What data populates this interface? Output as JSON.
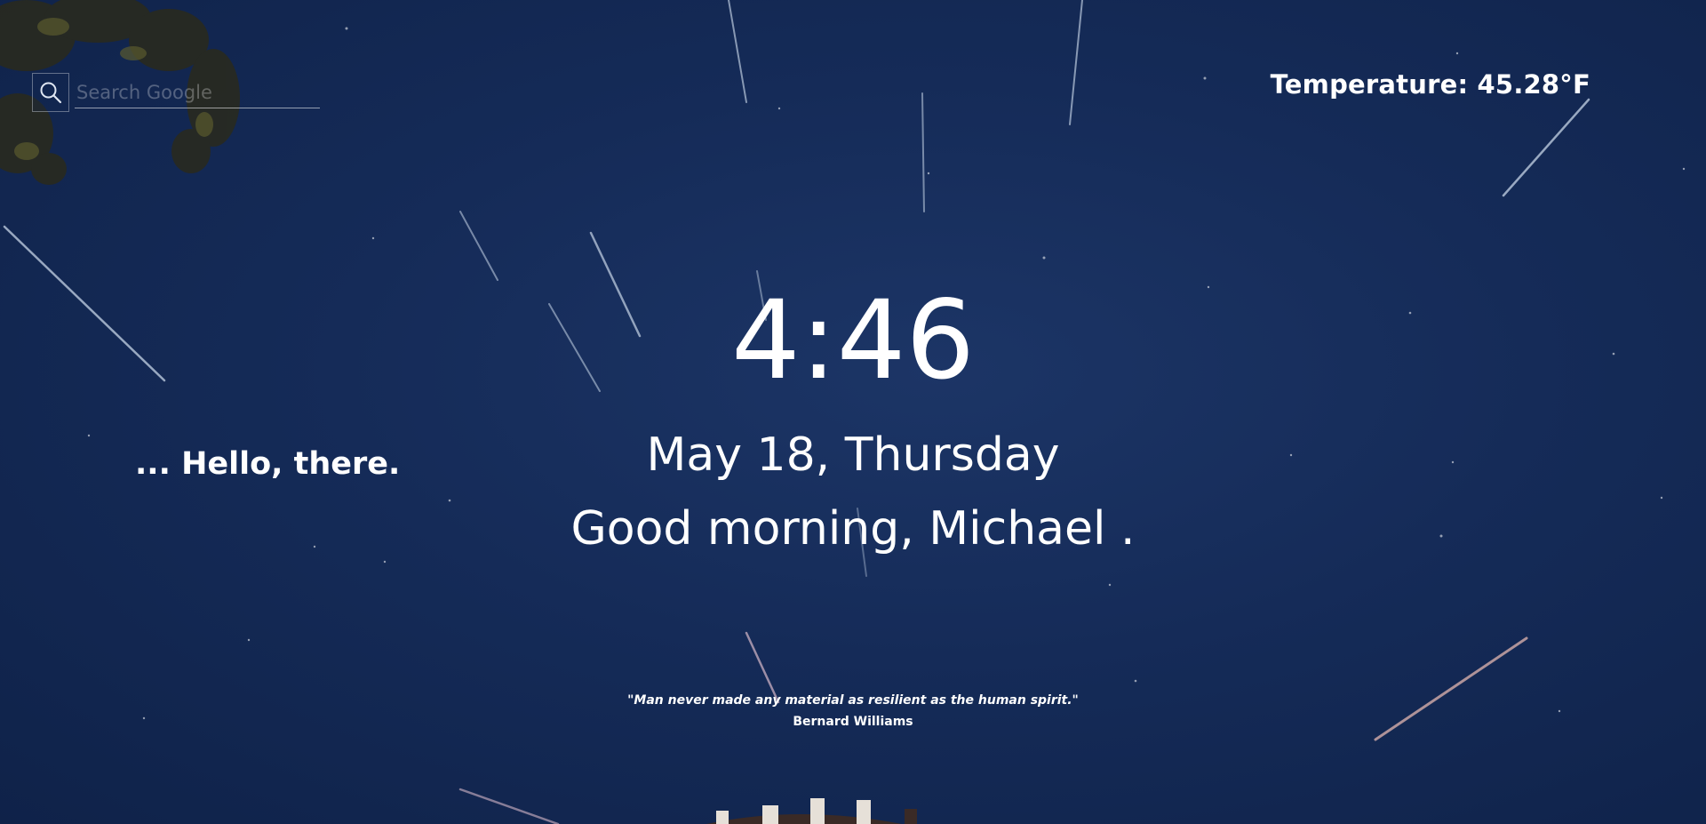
{
  "search": {
    "placeholder": "Search Google"
  },
  "weather": {
    "label": "Temperature: 45.28°F"
  },
  "clock": {
    "time": "4:46",
    "date": "May 18, Thursday"
  },
  "greeting": {
    "text": "Good morning, Michael ."
  },
  "hello": {
    "text": "... Hello, there."
  },
  "quote": {
    "text": "\"Man never made any material as resilient as the human spirit.\"",
    "author": "Bernard Williams"
  },
  "icons": {
    "search": "search-icon"
  },
  "colors": {
    "sky_dark": "#0f2249",
    "sky_mid": "#1c3566",
    "text": "#ffffff"
  }
}
